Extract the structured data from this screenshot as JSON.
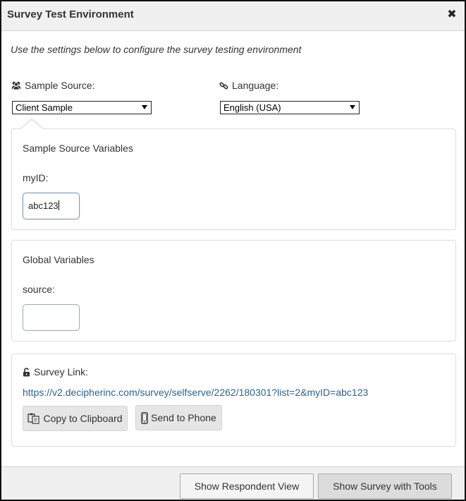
{
  "dialog": {
    "title": "Survey Test Environment",
    "close_icon": "close-icon"
  },
  "intro_text": "Use the settings below to configure the survey testing environment",
  "sample_source": {
    "label": "Sample Source:",
    "icon": "users-icon",
    "selected": "Client Sample"
  },
  "language": {
    "label": "Language:",
    "icon": "link-icon",
    "selected": "English (USA)"
  },
  "sample_source_variables": {
    "title": "Sample Source Variables",
    "field_label": "myID:",
    "field_value": "abc123"
  },
  "global_variables": {
    "title": "Global Variables",
    "field_label": "source:",
    "field_value": ""
  },
  "survey_link": {
    "label": "Survey Link:",
    "icon": "lock-icon",
    "url": "https://v2.decipherinc.com/survey/selfserve/2262/180301?list=2&myID=abc123",
    "copy_label": "Copy to Clipboard",
    "copy_icon": "clipboard-icon",
    "phone_label": "Send to Phone",
    "phone_icon": "phone-icon"
  },
  "footer": {
    "respondent_view_label": "Show Respondent View",
    "survey_tools_label": "Show Survey with Tools"
  },
  "colors": {
    "link": "#2a6496",
    "titlebar_bg": "#f0f0f0",
    "panel_border": "#dddddd"
  }
}
